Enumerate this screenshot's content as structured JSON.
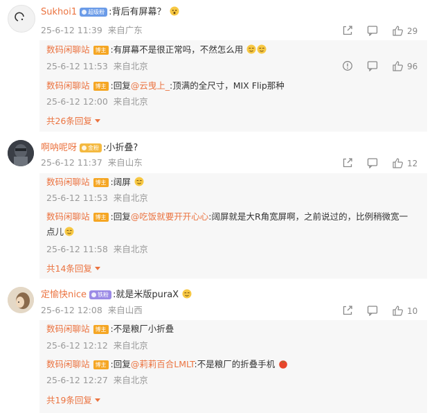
{
  "comments": [
    {
      "author": "Sukhoi1",
      "badge": "超级粉",
      "text": ":背后有屏幕？",
      "time": "25-6-12 11:39",
      "location": "来自广东",
      "likes": "29",
      "replies": [
        {
          "author": "数码闲聊站",
          "badge": "博主",
          "text": ":有屏幕不是很正常吗，不然怎么用",
          "time": "25-6-12 11:53",
          "location": "来自北京",
          "likes": "96"
        },
        {
          "author": "数码闲聊站",
          "badge": "博主",
          "prefix": ":回复",
          "mention": "@云曳上_",
          "text": ":顶满的全尺寸，MIX Flip那种",
          "time": "25-6-12 12:00",
          "location": "来自北京"
        }
      ],
      "more_replies": "共26条回复"
    },
    {
      "author": "啊呐呢呀",
      "badge": "金粉",
      "text": ":小折叠?",
      "time": "25-6-12 11:37",
      "location": "来自山东",
      "likes": "12",
      "replies": [
        {
          "author": "数码闲聊站",
          "badge": "博主",
          "text": ":阔屏",
          "time": "25-6-12 11:53",
          "location": "来自北京"
        },
        {
          "author": "数码闲聊站",
          "badge": "博主",
          "prefix": ":回复",
          "mention": "@吃饭就要开开心心",
          "text": ":阔屏就是大R角宽屏啊，之前说过的，比例稍微宽一",
          "text2": "点儿",
          "time": "25-6-12 11:58",
          "location": "来自北京"
        }
      ],
      "more_replies": "共14条回复"
    },
    {
      "author": "定愉快nice",
      "badge": "铁粉",
      "text": ":就是米版puraX",
      "time": "25-6-12 12:08",
      "location": "来自山西",
      "likes": "10",
      "replies": [
        {
          "author": "数码闲聊站",
          "badge": "博主",
          "text": ":不是粮厂小折叠",
          "time": "25-6-12 12:12",
          "location": "来自北京"
        },
        {
          "author": "数码闲聊站",
          "badge": "博主",
          "prefix": ":回复",
          "mention": "@莉莉百合LMLT",
          "text": ":不是粮厂的折叠手机",
          "time": "25-6-12 12:27",
          "location": "来自北京"
        }
      ],
      "more_replies": "共19条回复"
    }
  ],
  "icons": {
    "share": "share-icon",
    "comment": "comment-icon",
    "like": "thumbs-up-icon",
    "report": "report-icon",
    "emoji": "smile-emoji-icon",
    "expand": "chevron-down-icon"
  },
  "colors": {
    "accent": "#eb7340",
    "meta": "#999999",
    "reply_bg": "#f7f7f7"
  }
}
